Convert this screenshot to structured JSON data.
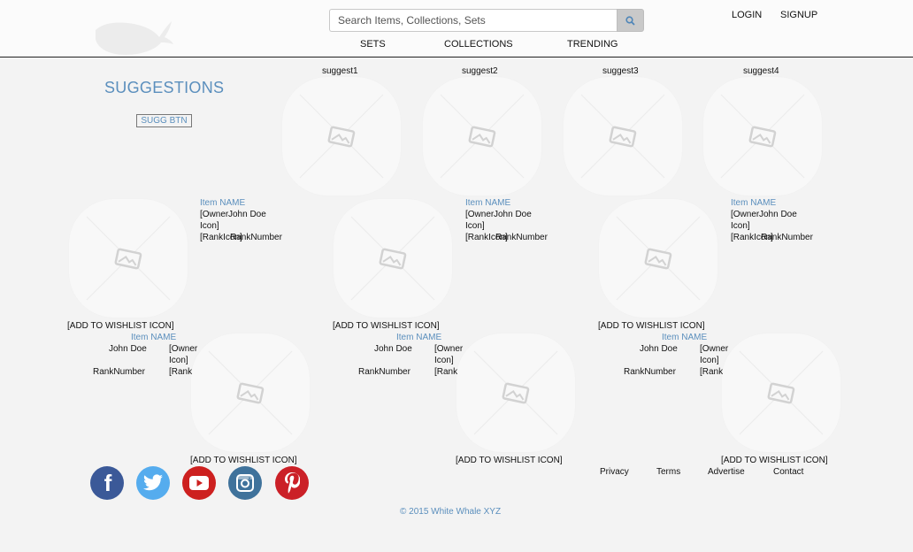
{
  "header": {
    "search_placeholder": "Search Items, Collections, Sets",
    "login": "LOGIN",
    "signup": "SIGNUP",
    "nav": [
      "SETS",
      "COLLECTIONS",
      "TRENDING"
    ]
  },
  "suggestions": {
    "title": "SUGGESTIONS",
    "button": "SUGG BTN",
    "labels": [
      "suggest1",
      "suggest2",
      "suggest3",
      "suggest4"
    ]
  },
  "items_row1": [
    {
      "name": "Item NAME",
      "owner_icon_1": "[Owner",
      "owner_name": "John Doe",
      "owner_icon_2": "Icon]",
      "rank_icon": "[RankIcon]",
      "rank_number": "RankNumber",
      "wishlist": "[ADD TO WISHLIST ICON]"
    },
    {
      "name": "Item NAME",
      "owner_icon_1": "[Owner",
      "owner_name": "John Doe",
      "owner_icon_2": "Icon]",
      "rank_icon": "[RankIcon]",
      "rank_number": "RankNumber",
      "wishlist": "[ADD TO WISHLIST ICON]"
    },
    {
      "name": "Item NAME",
      "owner_icon_1": "[Owner",
      "owner_name": "John Doe",
      "owner_icon_2": "Icon]",
      "rank_icon": "[RankIcon]",
      "rank_number": "RankNumber",
      "wishlist": "[ADD TO WISHLIST ICON]"
    }
  ],
  "items_row2": [
    {
      "name": "Item NAME",
      "owner_name": "John Doe",
      "owner_icon_1": "[Owner",
      "owner_icon_2": "Icon]",
      "rank_number": "RankNumber",
      "rank_icon": "[Rank",
      "wishlist": "[ADD TO WISHLIST ICON]"
    },
    {
      "name": "Item NAME",
      "owner_name": "John Doe",
      "owner_icon_1": "[Owner",
      "owner_icon_2": "Icon]",
      "rank_number": "RankNumber",
      "rank_icon": "[Rank",
      "wishlist": "[ADD TO WISHLIST ICON]"
    },
    {
      "name": "Item NAME",
      "owner_name": "John Doe",
      "owner_icon_1": "[Owner",
      "owner_icon_2": "Icon]",
      "rank_number": "RankNumber",
      "rank_icon": "[Rank",
      "wishlist": "[ADD TO WISHLIST ICON]"
    }
  ],
  "footer": {
    "social": [
      {
        "icon": "facebook-icon",
        "glyph": "f",
        "color": "#3b5998"
      },
      {
        "icon": "twitter-icon",
        "color": "#55acee"
      },
      {
        "icon": "youtube-icon",
        "color": "#cd201f"
      },
      {
        "icon": "instagram-icon",
        "color": "#3f729b"
      },
      {
        "icon": "pinterest-icon",
        "color": "#cb2027"
      }
    ],
    "links": [
      "Privacy",
      "Terms",
      "Advertise",
      "Contact"
    ],
    "copyright": "© 2015 White Whale XYZ"
  },
  "colors": {
    "accent": "#5b8fbd",
    "background": "#f3f3f3",
    "header_bg": "#fbfbfb"
  }
}
